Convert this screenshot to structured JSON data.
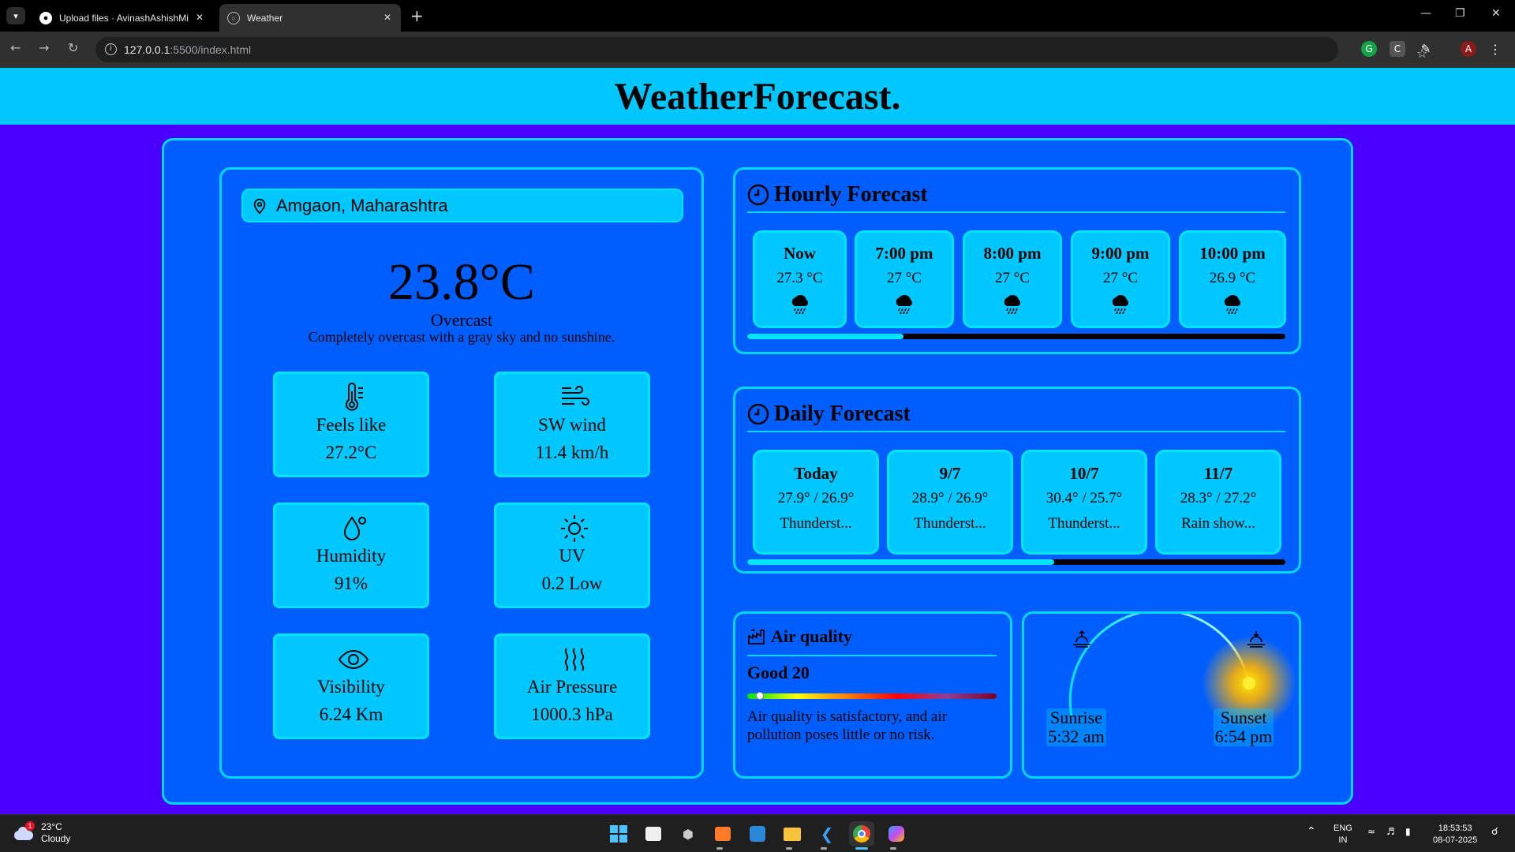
{
  "browser": {
    "tabs": [
      {
        "title": "Upload files · AvinashAshishMi",
        "active": false
      },
      {
        "title": "Weather",
        "active": true
      }
    ],
    "url_host": "127.0.0.1",
    "url_path": ":5500/index.html",
    "profile_initial": "A",
    "extension_c": "C"
  },
  "page": {
    "title": "WeatherForecast.",
    "location": "Amgaon, Maharashtra",
    "current": {
      "temperature": "23.8°C",
      "condition": "Overcast",
      "description": "Completely overcast with a gray sky and no sunshine."
    },
    "stats": [
      {
        "icon": "thermometer-icon",
        "label": "Feels like",
        "value": "27.2°C"
      },
      {
        "icon": "wind-icon",
        "label": "SW wind",
        "value": "11.4 km/h"
      },
      {
        "icon": "humidity-icon",
        "label": "Humidity",
        "value": "91%"
      },
      {
        "icon": "sun-icon",
        "label": "UV",
        "value": "0.2 Low"
      },
      {
        "icon": "eye-icon",
        "label": "Visibility",
        "value": "6.24 Km"
      },
      {
        "icon": "heat-waves-icon",
        "label": "Air Pressure",
        "value": "1000.3 hPa"
      }
    ],
    "hourly": {
      "title": "Hourly Forecast",
      "scroll_fraction": 0.29,
      "items": [
        {
          "time": "Now",
          "temp": "27.3 °C",
          "icon": "rain-cloud-icon"
        },
        {
          "time": "7:00 pm",
          "temp": "27 °C",
          "icon": "rain-cloud-icon"
        },
        {
          "time": "8:00 pm",
          "temp": "27 °C",
          "icon": "rain-cloud-icon"
        },
        {
          "time": "9:00 pm",
          "temp": "27 °C",
          "icon": "rain-cloud-icon"
        },
        {
          "time": "10:00 pm",
          "temp": "26.9 °C",
          "icon": "rain-cloud-icon"
        }
      ]
    },
    "daily": {
      "title": "Daily Forecast",
      "scroll_fraction": 0.57,
      "items": [
        {
          "day": "Today",
          "temps": "27.9° / 26.9°",
          "summary": "Thunderst..."
        },
        {
          "day": "9/7",
          "temps": "28.9° / 26.9°",
          "summary": "Thunderst..."
        },
        {
          "day": "10/7",
          "temps": "30.4° / 25.7°",
          "summary": "Thunderst..."
        },
        {
          "day": "11/7",
          "temps": "28.3° / 27.2°",
          "summary": "Rain show..."
        }
      ]
    },
    "air_quality": {
      "title": "Air quality",
      "status": "Good 20",
      "level_fraction": 0.05,
      "text": "Air quality is satisfactory, and air pollution poses little or no risk."
    },
    "sun": {
      "sunrise_label": "Sunrise",
      "sunrise_time": "5:32 am",
      "sunset_label": "Sunset",
      "sunset_time": "6:54 pm"
    }
  },
  "taskbar": {
    "weather_temp": "23°C",
    "weather_text": "Cloudy",
    "weather_badge": "1",
    "lang_line1": "ENG",
    "lang_line2": "IN",
    "time": "18:53:53",
    "date": "08-07-2025"
  },
  "colors": {
    "page_bg": "#4a00ff",
    "header_bg": "#00c8ff",
    "panel_bg": "#005eff",
    "card_bg": "#00c8ff",
    "border": "#00d8ff"
  }
}
